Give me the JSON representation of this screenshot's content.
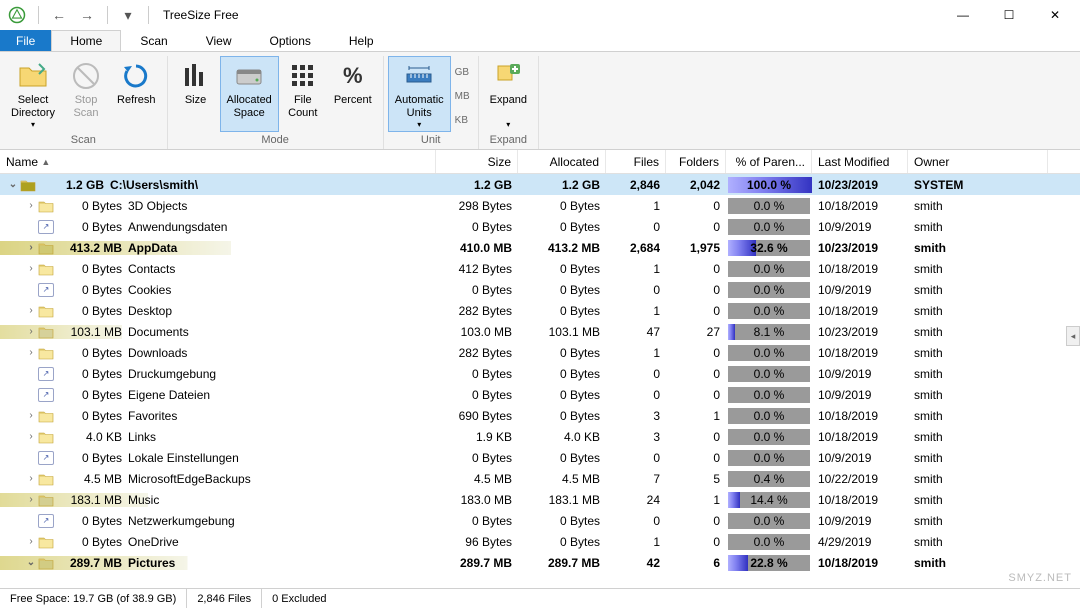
{
  "titlebar": {
    "app_name": "TreeSize Free"
  },
  "menu": {
    "file": "File",
    "tabs": [
      "Home",
      "Scan",
      "View",
      "Options",
      "Help"
    ],
    "active_tab": "Home"
  },
  "ribbon": {
    "scan": {
      "label": "Scan",
      "select_dir": "Select\nDirectory",
      "stop": "Stop\nScan",
      "refresh": "Refresh"
    },
    "mode": {
      "label": "Mode",
      "size": "Size",
      "alloc": "Allocated\nSpace",
      "files": "File\nCount",
      "percent": "Percent"
    },
    "unit": {
      "label": "Unit",
      "auto": "Automatic\nUnits",
      "gb": "GB",
      "mb": "MB",
      "kb": "KB"
    },
    "expand": {
      "label": "Expand",
      "btn": "Expand"
    }
  },
  "columns": {
    "name": "Name",
    "size": "Size",
    "alloc": "Allocated",
    "files": "Files",
    "folders": "Folders",
    "pct": "% of Paren...",
    "mod": "Last Modified",
    "owner": "Owner"
  },
  "rows": [
    {
      "depth": 0,
      "exp": "open",
      "ico": "folder",
      "bold": true,
      "sel": true,
      "shade": 100,
      "size_inline": "1.2 GB",
      "name": "C:\\Users\\smith\\",
      "size": "1.2 GB",
      "alloc": "1.2 GB",
      "files": "2,846",
      "folders": "2,042",
      "pct": "100.0 %",
      "pctv": 100,
      "mod": "10/23/2019",
      "owner": "SYSTEM"
    },
    {
      "depth": 1,
      "exp": "closed",
      "ico": "folder",
      "shade": 0,
      "size_inline": "0 Bytes",
      "name": "3D Objects",
      "size": "298 Bytes",
      "alloc": "0 Bytes",
      "files": "1",
      "folders": "0",
      "pct": "0.0 %",
      "pctv": 0,
      "mod": "10/18/2019",
      "owner": "smith"
    },
    {
      "depth": 1,
      "exp": "none",
      "ico": "junction",
      "shade": 0,
      "size_inline": "0 Bytes",
      "name": "Anwendungsdaten",
      "size": "0 Bytes",
      "alloc": "0 Bytes",
      "files": "0",
      "folders": "0",
      "pct": "0.0 %",
      "pctv": 0,
      "mod": "10/9/2019",
      "owner": "smith"
    },
    {
      "depth": 1,
      "exp": "closed",
      "ico": "folder",
      "bold": true,
      "shade": 33,
      "size_inline": "413.2 MB",
      "name": "AppData",
      "size": "410.0 MB",
      "alloc": "413.2 MB",
      "files": "2,684",
      "folders": "1,975",
      "pct": "32.6 %",
      "pctv": 32.6,
      "mod": "10/23/2019",
      "owner": "smith"
    },
    {
      "depth": 1,
      "exp": "closed",
      "ico": "folder",
      "shade": 0,
      "size_inline": "0 Bytes",
      "name": "Contacts",
      "size": "412 Bytes",
      "alloc": "0 Bytes",
      "files": "1",
      "folders": "0",
      "pct": "0.0 %",
      "pctv": 0,
      "mod": "10/18/2019",
      "owner": "smith"
    },
    {
      "depth": 1,
      "exp": "none",
      "ico": "junction",
      "shade": 0,
      "size_inline": "0 Bytes",
      "name": "Cookies",
      "size": "0 Bytes",
      "alloc": "0 Bytes",
      "files": "0",
      "folders": "0",
      "pct": "0.0 %",
      "pctv": 0,
      "mod": "10/9/2019",
      "owner": "smith"
    },
    {
      "depth": 1,
      "exp": "closed",
      "ico": "folder",
      "shade": 0,
      "size_inline": "0 Bytes",
      "name": "Desktop",
      "size": "282 Bytes",
      "alloc": "0 Bytes",
      "files": "1",
      "folders": "0",
      "pct": "0.0 %",
      "pctv": 0,
      "mod": "10/18/2019",
      "owner": "smith"
    },
    {
      "depth": 1,
      "exp": "closed",
      "ico": "folder",
      "shade": 8,
      "size_inline": "103.1 MB",
      "name": "Documents",
      "size": "103.0 MB",
      "alloc": "103.1 MB",
      "files": "47",
      "folders": "27",
      "pct": "8.1 %",
      "pctv": 8.1,
      "mod": "10/23/2019",
      "owner": "smith"
    },
    {
      "depth": 1,
      "exp": "closed",
      "ico": "folder",
      "shade": 0,
      "size_inline": "0 Bytes",
      "name": "Downloads",
      "size": "282 Bytes",
      "alloc": "0 Bytes",
      "files": "1",
      "folders": "0",
      "pct": "0.0 %",
      "pctv": 0,
      "mod": "10/18/2019",
      "owner": "smith"
    },
    {
      "depth": 1,
      "exp": "none",
      "ico": "junction",
      "shade": 0,
      "size_inline": "0 Bytes",
      "name": "Druckumgebung",
      "size": "0 Bytes",
      "alloc": "0 Bytes",
      "files": "0",
      "folders": "0",
      "pct": "0.0 %",
      "pctv": 0,
      "mod": "10/9/2019",
      "owner": "smith"
    },
    {
      "depth": 1,
      "exp": "none",
      "ico": "junction",
      "shade": 0,
      "size_inline": "0 Bytes",
      "name": "Eigene Dateien",
      "size": "0 Bytes",
      "alloc": "0 Bytes",
      "files": "0",
      "folders": "0",
      "pct": "0.0 %",
      "pctv": 0,
      "mod": "10/9/2019",
      "owner": "smith"
    },
    {
      "depth": 1,
      "exp": "closed",
      "ico": "folder",
      "shade": 0,
      "size_inline": "0 Bytes",
      "name": "Favorites",
      "size": "690 Bytes",
      "alloc": "0 Bytes",
      "files": "3",
      "folders": "1",
      "pct": "0.0 %",
      "pctv": 0,
      "mod": "10/18/2019",
      "owner": "smith"
    },
    {
      "depth": 1,
      "exp": "closed",
      "ico": "folder",
      "shade": 0,
      "size_inline": "4.0 KB",
      "name": "Links",
      "size": "1.9 KB",
      "alloc": "4.0 KB",
      "files": "3",
      "folders": "0",
      "pct": "0.0 %",
      "pctv": 0,
      "mod": "10/18/2019",
      "owner": "smith"
    },
    {
      "depth": 1,
      "exp": "none",
      "ico": "junction",
      "shade": 0,
      "size_inline": "0 Bytes",
      "name": "Lokale Einstellungen",
      "size": "0 Bytes",
      "alloc": "0 Bytes",
      "files": "0",
      "folders": "0",
      "pct": "0.0 %",
      "pctv": 0,
      "mod": "10/9/2019",
      "owner": "smith"
    },
    {
      "depth": 1,
      "exp": "closed",
      "ico": "folder",
      "shade": 0,
      "size_inline": "4.5 MB",
      "name": "MicrosoftEdgeBackups",
      "size": "4.5 MB",
      "alloc": "4.5 MB",
      "files": "7",
      "folders": "5",
      "pct": "0.4 %",
      "pctv": 0.4,
      "mod": "10/22/2019",
      "owner": "smith"
    },
    {
      "depth": 1,
      "exp": "closed",
      "ico": "folder",
      "shade": 14,
      "size_inline": "183.1 MB",
      "name": "Music",
      "size": "183.0 MB",
      "alloc": "183.1 MB",
      "files": "24",
      "folders": "1",
      "pct": "14.4 %",
      "pctv": 14.4,
      "mod": "10/18/2019",
      "owner": "smith"
    },
    {
      "depth": 1,
      "exp": "none",
      "ico": "junction",
      "shade": 0,
      "size_inline": "0 Bytes",
      "name": "Netzwerkumgebung",
      "size": "0 Bytes",
      "alloc": "0 Bytes",
      "files": "0",
      "folders": "0",
      "pct": "0.0 %",
      "pctv": 0,
      "mod": "10/9/2019",
      "owner": "smith"
    },
    {
      "depth": 1,
      "exp": "closed",
      "ico": "folder",
      "shade": 0,
      "size_inline": "0 Bytes",
      "name": "OneDrive",
      "size": "96 Bytes",
      "alloc": "0 Bytes",
      "files": "1",
      "folders": "0",
      "pct": "0.0 %",
      "pctv": 0,
      "mod": "4/29/2019",
      "owner": "smith"
    },
    {
      "depth": 1,
      "exp": "open",
      "ico": "folder",
      "bold": true,
      "shade": 23,
      "size_inline": "289.7 MB",
      "name": "Pictures",
      "size": "289.7 MB",
      "alloc": "289.7 MB",
      "files": "42",
      "folders": "6",
      "pct": "22.8 %",
      "pctv": 22.8,
      "mod": "10/18/2019",
      "owner": "smith"
    }
  ],
  "status": {
    "free": "Free Space: 19.7 GB  (of 38.9 GB)",
    "files": "2,846 Files",
    "excluded": "0 Excluded"
  },
  "watermark": "SMYZ.NET"
}
